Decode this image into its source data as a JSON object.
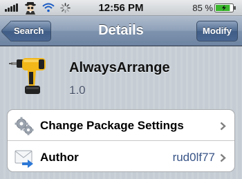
{
  "status_bar": {
    "time": "12:56 PM",
    "battery_percent": "85 %",
    "battery_level": 0.85,
    "icons": [
      "signal-icon",
      "spy-icon",
      "wifi-icon",
      "activity-spinner-icon",
      "battery-icon"
    ]
  },
  "nav_bar": {
    "back_label": "Search",
    "title": "Details",
    "right_button_label": "Modify"
  },
  "package": {
    "name": "AlwaysArrange",
    "version": "1.0",
    "icon": "drill-icon"
  },
  "rows": [
    {
      "label": "Change Package Settings",
      "value": "",
      "icon": "gears-icon"
    },
    {
      "label": "Author",
      "value": "rud0lf77",
      "icon": "mail-icon"
    }
  ],
  "colors": {
    "nav_gradient_top": "#b0bccd",
    "nav_gradient_bottom": "#6d84a2",
    "background": "#c5ccd4",
    "version_text": "#4c566c",
    "value_text": "#385487",
    "battery_fill": "#3cb62e"
  }
}
